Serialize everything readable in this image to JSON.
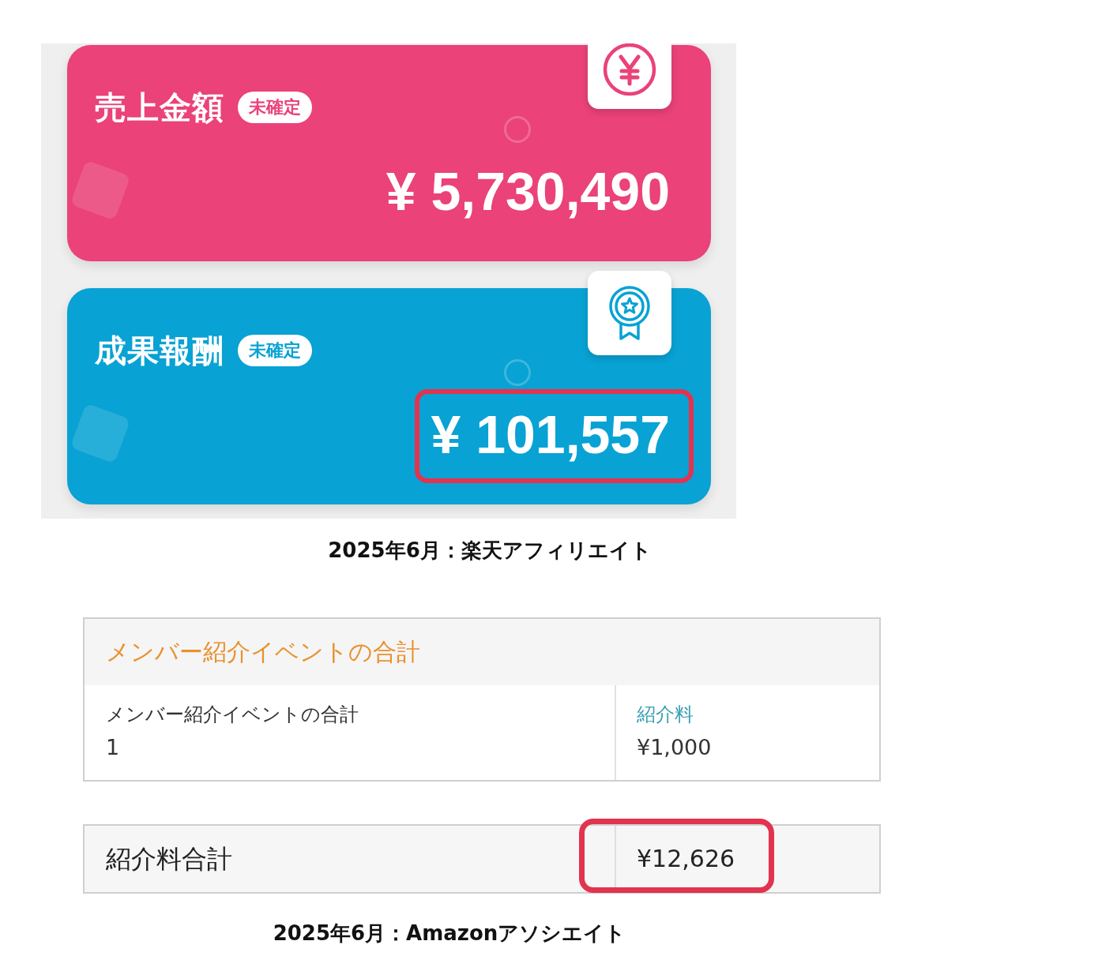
{
  "rakuten_screenshot": {
    "cards": [
      {
        "kind": "sales",
        "title": "売上金額",
        "badge": "未確定",
        "amount": "¥ 5,730,490",
        "color": "#ea4279",
        "highlighted": false
      },
      {
        "kind": "reward",
        "title": "成果報酬",
        "badge": "未確定",
        "amount": "¥ 101,557",
        "color": "#08a2d4",
        "highlighted": true
      }
    ]
  },
  "caption_1": "2025年6月：楽天アフィリエイト",
  "amazon_screenshot": {
    "section_title": "メンバー紹介イベントの合計",
    "cells": [
      {
        "kind": "text",
        "label": "メンバー紹介イベントの合計",
        "value": "1"
      },
      {
        "kind": "link",
        "label": "紹介料",
        "value": "¥1,000"
      }
    ],
    "total": {
      "label": "紹介料合計",
      "value": "¥12,626",
      "highlighted": true
    }
  },
  "caption_2": "2025年6月：Amazonアソシエイト"
}
